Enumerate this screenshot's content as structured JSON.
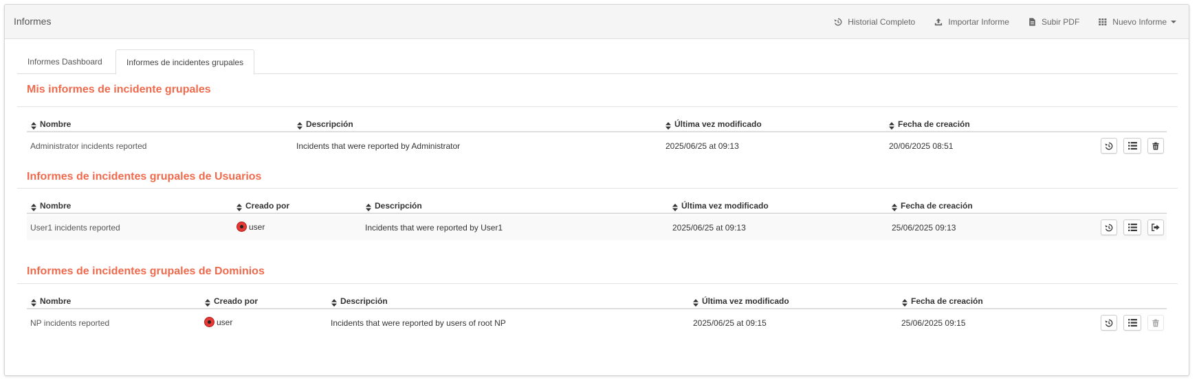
{
  "header": {
    "title": "Informes",
    "actions": {
      "history": "Historial Completo",
      "import": "Importar Informe",
      "upload_pdf": "Subir PDF",
      "new_report": "Nuevo Informe"
    }
  },
  "tabs": {
    "dashboard": "Informes Dashboard",
    "group_incidents": "Informes de incidentes grupales"
  },
  "my_reports": {
    "title": "Mis informes de incidente grupales",
    "columns": {
      "name": "Nombre",
      "description": "Descripción",
      "modified": "Última vez modificado",
      "created": "Fecha de creación"
    },
    "rows": [
      {
        "name": "Administrator incidents reported",
        "description": "Incidents that were reported by Administrator",
        "modified": "2025/06/25 at 09:13",
        "created": "20/06/2025 08:51"
      }
    ]
  },
  "user_reports": {
    "title": "Informes de incidentes grupales de Usuarios",
    "columns": {
      "name": "Nombre",
      "created_by": "Creado por",
      "description": "Descripción",
      "modified": "Última vez modificado",
      "created": "Fecha de creación"
    },
    "rows": [
      {
        "name": "User1 incidents reported",
        "created_by": "user",
        "description": "Incidents that were reported by User1",
        "modified": "2025/06/25 at 09:13",
        "created": "25/06/2025 09:13"
      }
    ]
  },
  "domain_reports": {
    "title": "Informes de incidentes grupales de Dominios",
    "columns": {
      "name": "Nombre",
      "created_by": "Creado por",
      "description": "Descripción",
      "modified": "Última vez modificado",
      "created": "Fecha de creación"
    },
    "rows": [
      {
        "name": "NP incidents reported",
        "created_by": "user",
        "description": "Incidents that were reported by users of root NP",
        "modified": "2025/06/25 at 09:15",
        "created": "25/06/2025 09:15"
      }
    ]
  },
  "colors": {
    "section_title": "#ef6a4c",
    "avatar": "#e53935"
  },
  "icons": {
    "history": "history-icon",
    "import": "upload-icon",
    "upload_pdf": "file-icon",
    "new_report": "grid-icon",
    "sort": "sort-icon",
    "list": "list-icon",
    "delete": "trash-icon",
    "unsubscribe": "sign-out-icon"
  }
}
